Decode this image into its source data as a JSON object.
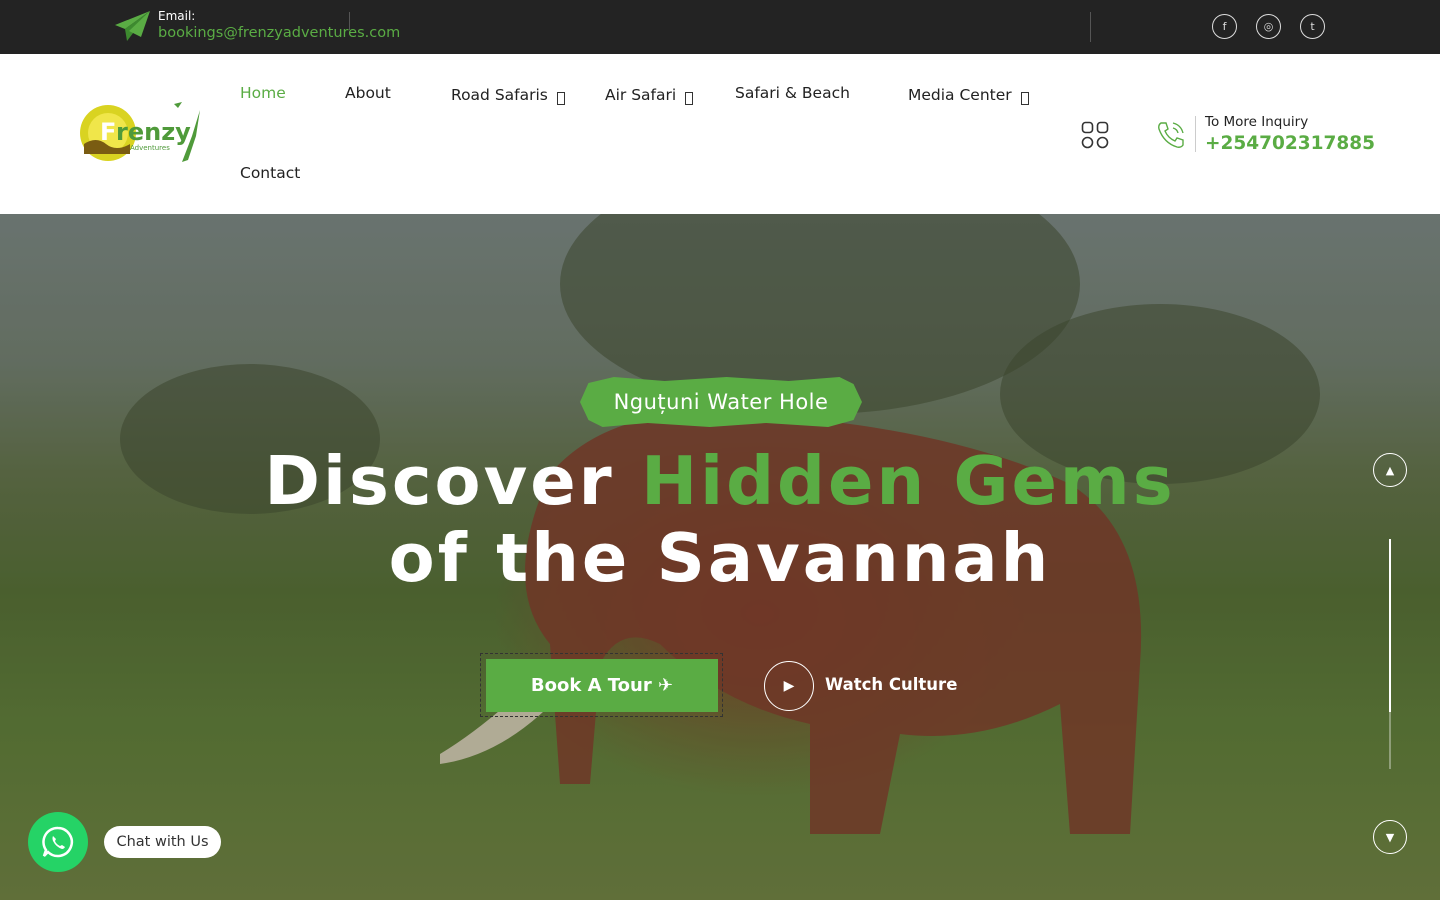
{
  "topbar": {
    "email_label": "Email:",
    "email_value": "bookings@frenzyadventures.com",
    "social_icons": [
      "facebook-icon",
      "instagram-icon",
      "twitter-icon"
    ]
  },
  "header": {
    "logo_text": "Frenzy",
    "logo_subtext": "Adventures",
    "nav": [
      {
        "label": "Home",
        "active": true,
        "has_dropdown": false
      },
      {
        "label": "About",
        "active": false,
        "has_dropdown": false
      },
      {
        "label": "Road Safaris",
        "active": false,
        "has_dropdown": true
      },
      {
        "label": "Air Safari",
        "active": false,
        "has_dropdown": true
      },
      {
        "label": "Safari & Beach",
        "active": false,
        "has_dropdown": false
      },
      {
        "label": "Media Center",
        "active": false,
        "has_dropdown": true
      },
      {
        "label": "Contact",
        "active": false,
        "has_dropdown": false
      }
    ],
    "inquiry_label": "To More Inquiry",
    "inquiry_phone": "+254702317885"
  },
  "hero": {
    "tag": "Nguțuni Water Hole",
    "headline_line1_prefix": "Discover",
    "headline_line1_accent": "Hidden Gems",
    "headline_line2": "of the Savannah",
    "book_button": "Book A Tour ✈",
    "watch_label": "Watch Culture",
    "slider_progress": 0.75
  },
  "whatsapp": {
    "chip_label": "Chat with Us"
  },
  "colors": {
    "accent": "#5aac44",
    "topbar_bg": "#232323",
    "whatsapp": "#25d366"
  }
}
